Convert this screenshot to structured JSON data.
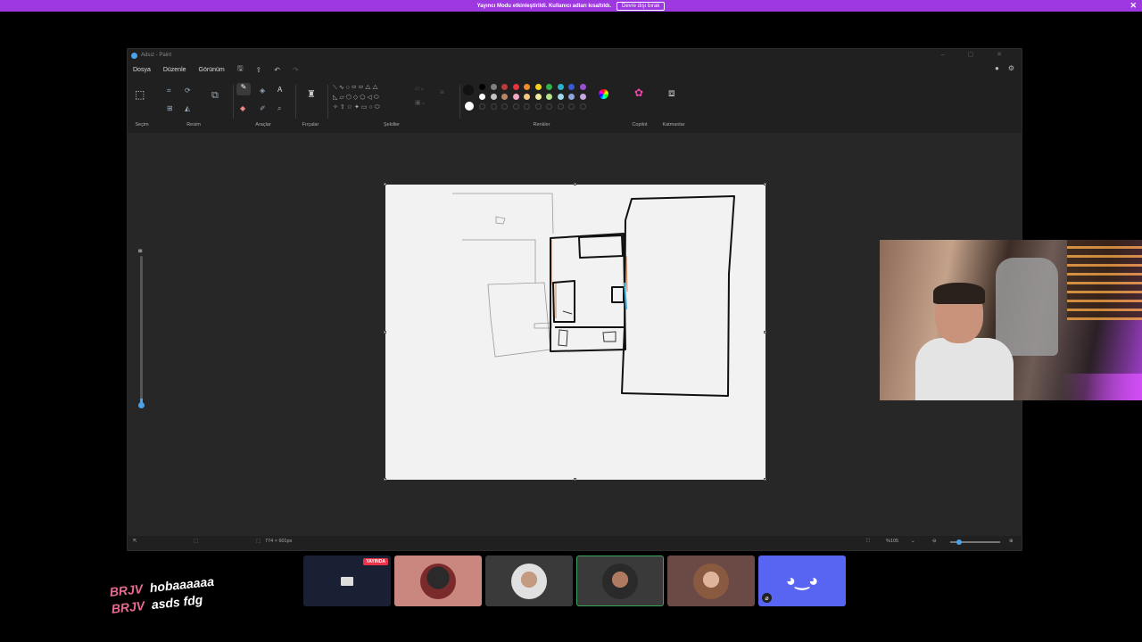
{
  "banner": {
    "text": "Yayıncı Modu etkinleştirildi. Kullanıcı adları kısaltıldı.",
    "button_label": "Devre dışı bırak",
    "close_icon": "✕"
  },
  "window": {
    "title": "Adsız - Paint",
    "controls": "– ▢ ✕"
  },
  "menu": {
    "items": [
      "Dosya",
      "Düzenle",
      "Görünüm"
    ],
    "quick_icons": [
      "save-icon",
      "share-icon",
      "undo-icon",
      "redo-icon"
    ]
  },
  "ribbon": {
    "groups": {
      "selection": "Seçim",
      "image": "Resim",
      "tools": "Araçlar",
      "brushes": "Fırçalar",
      "shapes": "Şekiller",
      "colors": "Renkler",
      "copilot": "Copilot",
      "layers": "Katmanlar"
    },
    "palette_row1": [
      "#000000",
      "#7f7f7f",
      "#b83a3a",
      "#e8333a",
      "#f08a2a",
      "#f3d21f",
      "#2fb24a",
      "#2ab0c8",
      "#3a57d6",
      "#9b4fd1"
    ],
    "palette_row2": [
      "#ffffff",
      "#c3c3c3",
      "#b58767",
      "#f2a7c3",
      "#f5c77e",
      "#f3ec9e",
      "#b6e38b",
      "#9fd9ea",
      "#8fa3e0",
      "#c8a6e0"
    ],
    "primary_color": "#111111",
    "secondary_color": "#ffffff"
  },
  "status": {
    "canvas_size": "774 × 601px",
    "zoom": "%105",
    "zoom_level": 0.12
  },
  "participants": {
    "live_badge": "YAYINDA",
    "tiles": [
      {
        "name": "screen-share-tile",
        "bg": "#1a2033"
      },
      {
        "name": "participant-2-tile",
        "bg": "#c9877f"
      },
      {
        "name": "participant-3-tile",
        "bg": "#3a3a3a"
      },
      {
        "name": "participant-4-tile",
        "bg": "#3a3a3a"
      },
      {
        "name": "participant-5-tile",
        "bg": "#6b4a45"
      },
      {
        "name": "discord-tile",
        "bg": "#5865f2"
      }
    ]
  },
  "chat": [
    {
      "user": "BRJV",
      "message": "hobaaaaaa"
    },
    {
      "user": "BRJV",
      "message": "asds fdg"
    }
  ]
}
